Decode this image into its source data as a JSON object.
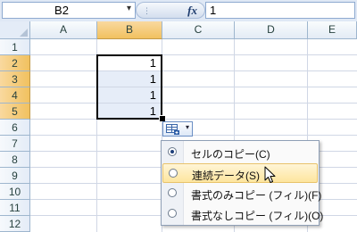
{
  "formula_bar": {
    "name_box": "B2",
    "name_box_arrow": "▾",
    "fx_label": "fx",
    "fx_dots": "⋮",
    "formula_value": "1"
  },
  "sheet": {
    "columns": [
      "A",
      "B",
      "C",
      "D",
      "E"
    ],
    "selected_column": "B",
    "rows": [
      "1",
      "2",
      "3",
      "4",
      "5",
      "6",
      "7",
      "8",
      "9",
      "10",
      "11",
      "12"
    ],
    "selected_rows": [
      "2",
      "3",
      "4",
      "5"
    ],
    "cells": [
      {
        "ref": "B2",
        "value": "1"
      },
      {
        "ref": "B3",
        "value": "1"
      },
      {
        "ref": "B4",
        "value": "1"
      },
      {
        "ref": "B5",
        "value": "1"
      }
    ],
    "selection_highlight_color": "#e6edf8",
    "header_highlight_color": "#f1c15f"
  },
  "autofill": {
    "button_icon": "autofill-options-icon",
    "arrow": "▾",
    "menu": [
      {
        "label": "セルのコピー(C)",
        "checked": true,
        "highlighted": false
      },
      {
        "label": "連続データ(S)",
        "checked": false,
        "highlighted": true
      },
      {
        "label": "書式のみコピー (フィル)(F)",
        "checked": false,
        "highlighted": false
      },
      {
        "label": "書式なしコピー (フィル)(O)",
        "checked": false,
        "highlighted": false
      }
    ]
  }
}
